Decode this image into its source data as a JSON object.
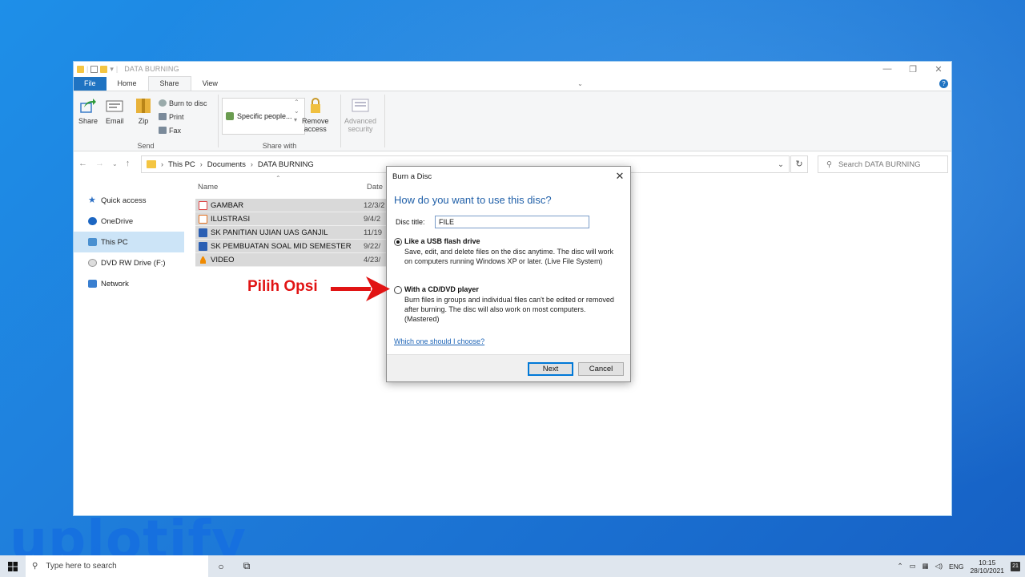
{
  "explorer": {
    "title": "DATA BURNING",
    "tabs": [
      "File",
      "Home",
      "Share",
      "View"
    ],
    "ribbon": {
      "send": {
        "share": "Share",
        "email": "Email",
        "zip": "Zip",
        "burn": "Burn to disc",
        "print": "Print",
        "fax": "Fax",
        "group": "Send"
      },
      "share_with": {
        "specific": "Specific people...",
        "remove": "Remove",
        "remove2": "access",
        "group": "Share with"
      },
      "advanced": {
        "line1": "Advanced",
        "line2": "security"
      }
    },
    "address": [
      "This PC",
      "Documents",
      "DATA BURNING"
    ],
    "search_placeholder": "Search DATA BURNING",
    "sidebar": [
      "Quick access",
      "OneDrive",
      "This PC",
      "DVD RW Drive (F:)",
      "Network"
    ],
    "columns": {
      "name": "Name",
      "date": "Date"
    },
    "files": [
      {
        "name": "GAMBAR",
        "date": "12/3/2"
      },
      {
        "name": "ILUSTRASI",
        "date": "9/4/2"
      },
      {
        "name": "SK PANITIAN UJIAN UAS GANJIL",
        "date": "11/19"
      },
      {
        "name": "SK PEMBUATAN SOAL MID SEMESTER",
        "date": "9/22/"
      },
      {
        "name": "VIDEO",
        "date": "4/23/"
      }
    ]
  },
  "dialog": {
    "title": "Burn a Disc",
    "question": "How do you want to use this disc?",
    "disc_title_label": "Disc title:",
    "disc_title_value": "FILE",
    "option1": {
      "title": "Like a USB flash drive",
      "desc": "Save, edit, and delete files on the disc anytime. The disc will work on computers running Windows XP or later. (Live File System)"
    },
    "option2": {
      "title": "With a CD/DVD player",
      "desc": "Burn files in groups and individual files can't be edited or removed after burning. The disc will also work on most computers. (Mastered)"
    },
    "help_link": "Which one should I choose?",
    "next": "Next",
    "cancel": "Cancel"
  },
  "annotation": "Pilih Opsi",
  "watermark": "uplotify",
  "taskbar": {
    "search": "Type here to search",
    "lang": "ENG",
    "time": "10:15",
    "date": "28/10/2021",
    "notif_count": "21"
  }
}
